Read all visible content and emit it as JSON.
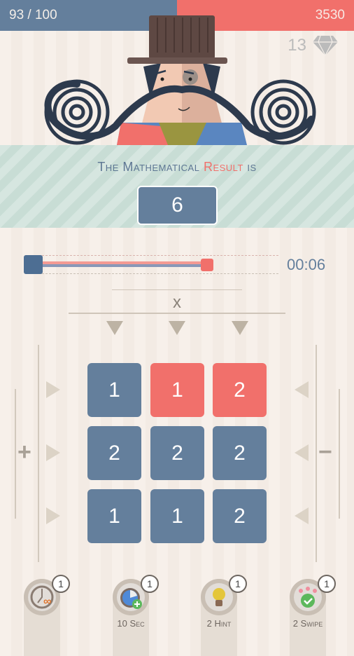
{
  "header": {
    "progress": "93 / 100",
    "score": "3530",
    "gems": "13",
    "gem_icon": "diamond-icon"
  },
  "banner": {
    "part1": "The Mathematical ",
    "part2": "Result",
    "part3": " is",
    "result": "6"
  },
  "timer": {
    "value": "00:06",
    "slider_fraction": 0.71
  },
  "operator": "x",
  "colors": {
    "blue": "#647f9c",
    "red": "#f1706b"
  },
  "grid": [
    [
      {
        "v": "1",
        "c": "blue"
      },
      {
        "v": "1",
        "c": "red"
      },
      {
        "v": "2",
        "c": "red"
      }
    ],
    [
      {
        "v": "2",
        "c": "blue"
      },
      {
        "v": "2",
        "c": "blue"
      },
      {
        "v": "2",
        "c": "blue"
      }
    ],
    [
      {
        "v": "1",
        "c": "blue"
      },
      {
        "v": "1",
        "c": "blue"
      },
      {
        "v": "2",
        "c": "blue"
      }
    ]
  ],
  "signs": {
    "plus": "+",
    "minus": "−"
  },
  "powerups": [
    {
      "icon": "infinite-time-icon",
      "count": "1",
      "label": ""
    },
    {
      "icon": "stopwatch-plus-icon",
      "count": "1",
      "label": "10 Sec"
    },
    {
      "icon": "lightbulb-icon",
      "count": "1",
      "label": "2 Hint"
    },
    {
      "icon": "swipe-check-icon",
      "count": "1",
      "label": "2 Swipe"
    }
  ]
}
